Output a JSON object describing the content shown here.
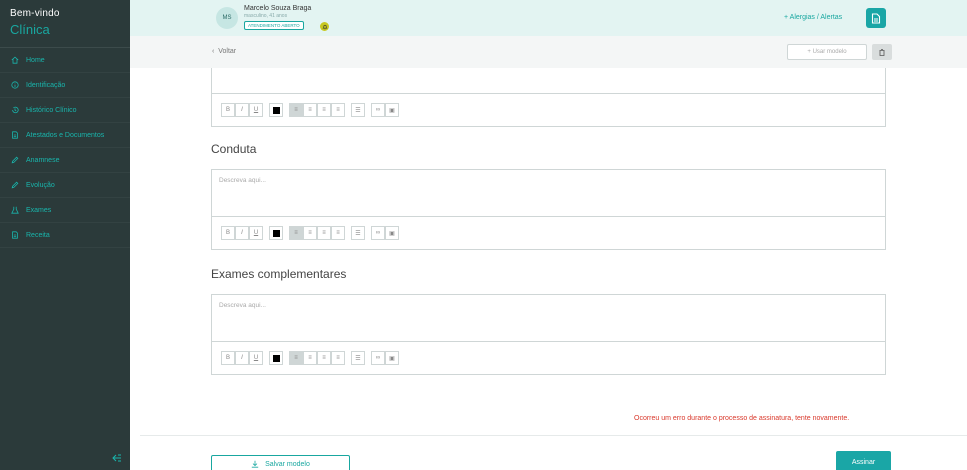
{
  "sidebar": {
    "brand_title": "Bem-vindo",
    "brand_subtitle": "Clínica",
    "items": [
      {
        "label": "Home",
        "icon": "home-icon"
      },
      {
        "label": "Identificação",
        "icon": "info-icon"
      },
      {
        "label": "Histórico Clínico",
        "icon": "history-icon"
      },
      {
        "label": "Atestados e Documentos",
        "icon": "document-icon"
      },
      {
        "label": "Anamnese",
        "icon": "pencil-icon"
      },
      {
        "label": "Evolução",
        "icon": "pencil-icon"
      },
      {
        "label": "Exames",
        "icon": "flask-icon"
      },
      {
        "label": "Receita",
        "icon": "document-icon"
      }
    ],
    "collapse_icon": "collapse-icon"
  },
  "header": {
    "avatar_initials": "MS",
    "patient_name": "Marcelo Souza Braga",
    "patient_info": "masculino, 41 anos",
    "status_badge": "ATENDIMENTO ABERTO",
    "alerts_link": "+ Alergias / Alertas"
  },
  "subbar": {
    "back_label": "Voltar",
    "use_model_label": "+ Usar modelo"
  },
  "editors": {
    "placeholder": "Descreva aqui...",
    "toolbar": {
      "bold": "B",
      "italic": "I",
      "underline": "U"
    },
    "sections": [
      {
        "title": ""
      },
      {
        "title": "Conduta"
      },
      {
        "title": "Exames complementares"
      }
    ]
  },
  "footer": {
    "error_message": "Ocorreu um erro durante o processo de assinatura, tente novamente.",
    "save_model_label": "Salvar modelo",
    "sign_label": "Assinar"
  },
  "colors": {
    "sidebar_bg": "#2b3a3a",
    "accent": "#1aa6a6",
    "header_bg": "#e3f4f2",
    "error": "#d9382b"
  }
}
